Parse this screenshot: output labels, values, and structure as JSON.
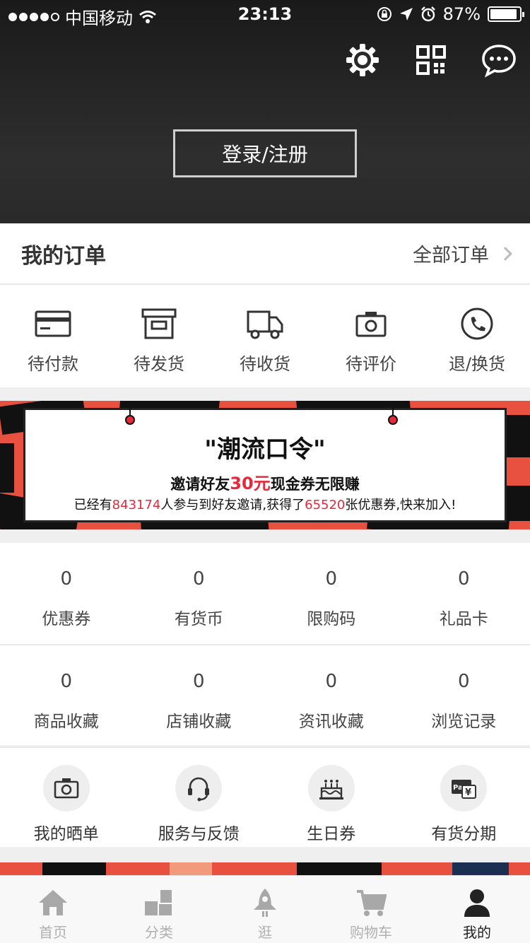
{
  "status_bar": {
    "carrier": "中国移动",
    "time": "23:13",
    "battery": "87%"
  },
  "header": {
    "login_label": "登录/注册"
  },
  "orders": {
    "title": "我的订单",
    "all_label": "全部订单",
    "items": [
      {
        "label": "待付款",
        "icon": "card-icon"
      },
      {
        "label": "待发货",
        "icon": "box-icon"
      },
      {
        "label": "待收货",
        "icon": "truck-icon"
      },
      {
        "label": "待评价",
        "icon": "camera-icon"
      },
      {
        "label": "退/换货",
        "icon": "phone-icon"
      }
    ]
  },
  "banner": {
    "title": "\"潮流口令\"",
    "subtitle_pre": "邀请好友",
    "subtitle_amount": "30元",
    "subtitle_post": "现金券无限赚",
    "detail_1": "已经有",
    "detail_count": "843174",
    "detail_2": "人参与到好友邀请,获得了",
    "detail_coupons": "65520",
    "detail_3": "张优惠券,快来加入!"
  },
  "stats": {
    "row1": [
      {
        "value": "0",
        "label": "优惠券"
      },
      {
        "value": "0",
        "label": "有货币"
      },
      {
        "value": "0",
        "label": "限购码"
      },
      {
        "value": "0",
        "label": "礼品卡"
      }
    ],
    "row2": [
      {
        "value": "0",
        "label": "商品收藏"
      },
      {
        "value": "0",
        "label": "店铺收藏"
      },
      {
        "value": "0",
        "label": "资讯收藏"
      },
      {
        "value": "0",
        "label": "浏览记录"
      }
    ]
  },
  "services": [
    {
      "label": "我的晒单",
      "icon": "camera-icon"
    },
    {
      "label": "服务与反馈",
      "icon": "headset-icon"
    },
    {
      "label": "生日券",
      "icon": "cake-icon"
    },
    {
      "label": "有货分期",
      "icon": "pay-icon"
    }
  ],
  "tabbar": [
    {
      "label": "首页",
      "icon": "home-icon"
    },
    {
      "label": "分类",
      "icon": "category-icon"
    },
    {
      "label": "逛",
      "icon": "rocket-icon"
    },
    {
      "label": "购物车",
      "icon": "cart-icon"
    },
    {
      "label": "我的",
      "icon": "user-icon"
    }
  ],
  "colors": {
    "accent_red": "#e8283b",
    "banner_red": "#e8503f",
    "header_dark": "#222222"
  }
}
